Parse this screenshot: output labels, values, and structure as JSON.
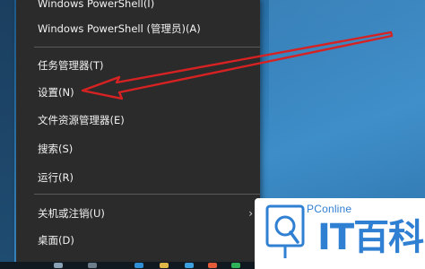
{
  "context_menu": {
    "items": [
      {
        "label": "Windows PowerShell(I)"
      },
      {
        "label": "Windows PowerShell (管理员)(A)"
      },
      {
        "label": "任务管理器(T)"
      },
      {
        "label": "设置(N)"
      },
      {
        "label": "文件资源管理器(E)"
      },
      {
        "label": "搜索(S)"
      },
      {
        "label": "运行(R)"
      },
      {
        "label": "关机或注销(U)"
      },
      {
        "label": "桌面(D)"
      }
    ]
  },
  "icons": {
    "submenu": "chevron-right-icon",
    "search": "search-icon",
    "annotation": "red-arrow-icon"
  },
  "colors": {
    "menu_bg": "#2b2b2b",
    "menu_text": "#f2f2f2",
    "arrow": "#d62222",
    "logo_blue": "#2f7fd2"
  },
  "watermark": {
    "brand_small": "PConline",
    "brand_big": "IT百科"
  }
}
